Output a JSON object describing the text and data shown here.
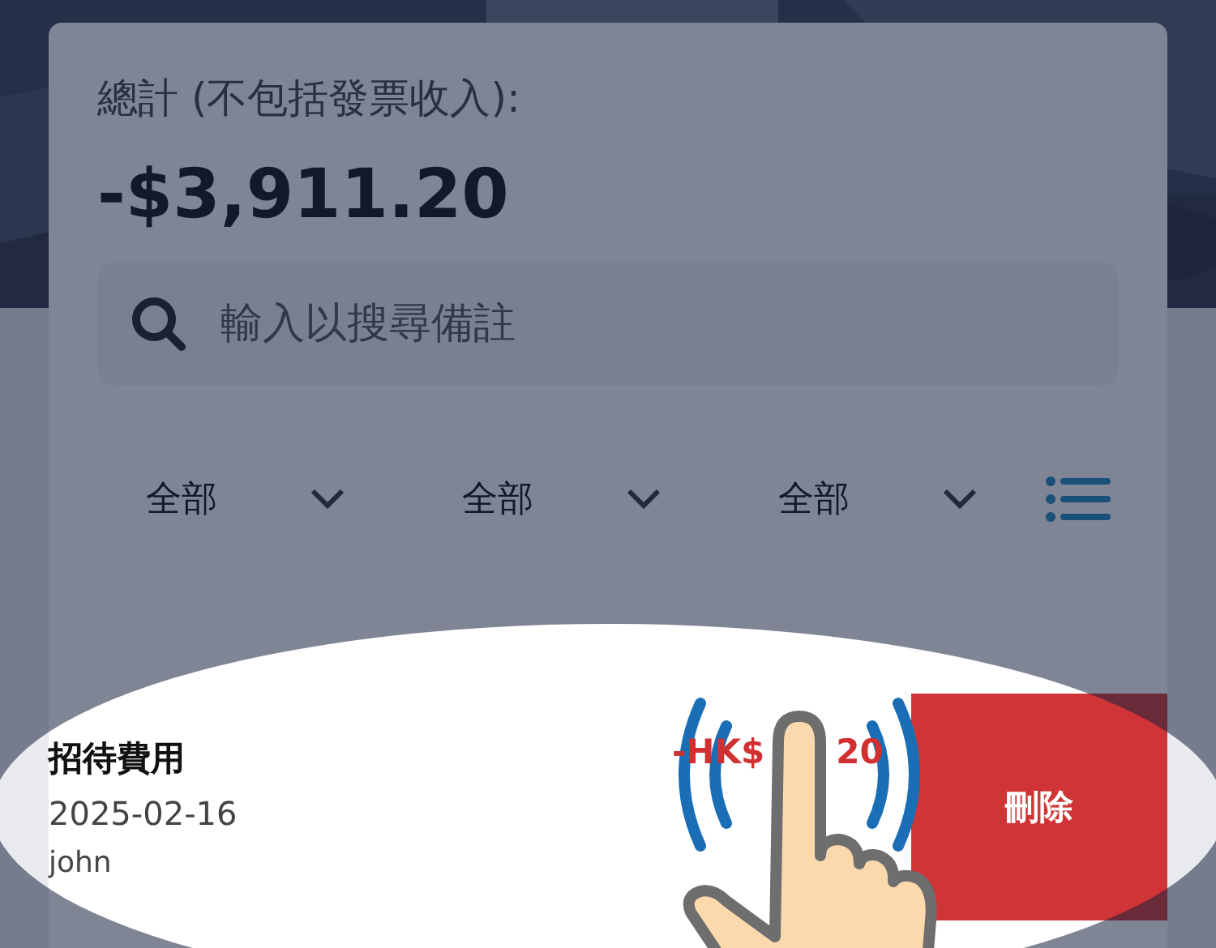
{
  "summary": {
    "label": "總計 (不包括發票收入):",
    "total": "-$3,911.20"
  },
  "search": {
    "placeholder": "輸入以搜尋備註"
  },
  "filters": [
    {
      "label": "全部"
    },
    {
      "label": "全部"
    },
    {
      "label": "全部"
    }
  ],
  "entries": [
    {
      "category": "招待費用",
      "amount_parts": [
        "-HK$",
        "20"
      ],
      "date": "2025-02-16",
      "user": "john",
      "action": "刪除"
    }
  ]
}
